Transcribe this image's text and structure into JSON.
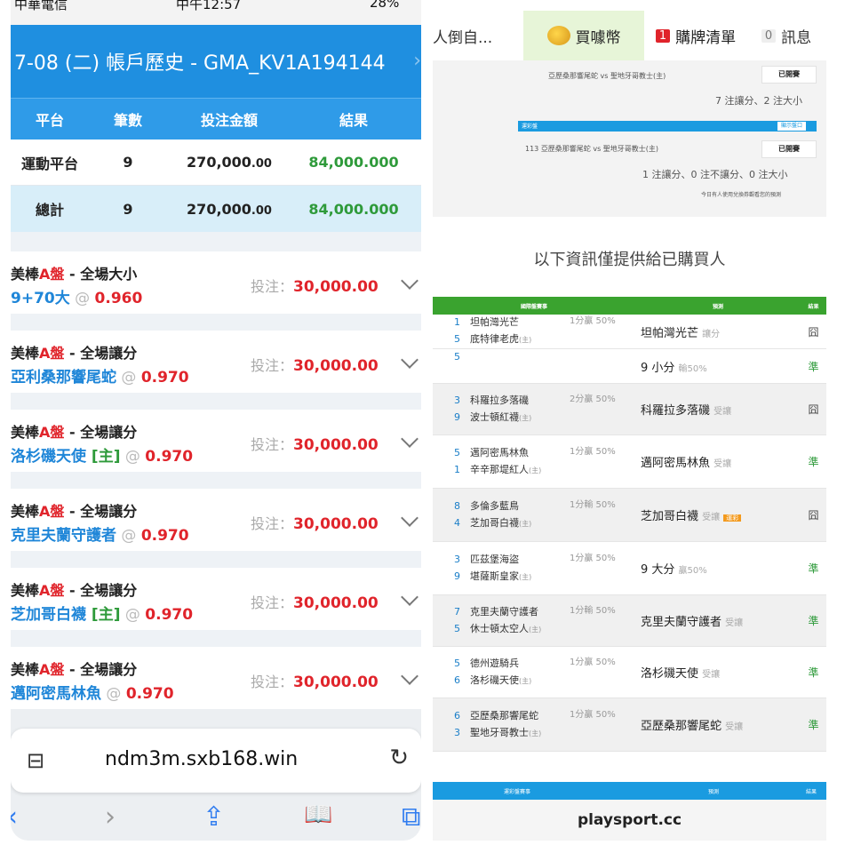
{
  "left": {
    "status": {
      "carrier": "中華電信",
      "time": "中午12:57",
      "battery": "28%"
    },
    "title": "7-08 (二) 帳戶歷史 - GMA_KV1A194144",
    "columns": [
      "平台",
      "筆數",
      "投注金額",
      "結果"
    ],
    "rows": [
      {
        "platform": "運動平台",
        "count": "9",
        "amount": "270,000",
        "amount_dec": ".00",
        "result": "84,000.000"
      },
      {
        "platform": "總計",
        "count": "9",
        "amount": "270,000",
        "amount_dec": ".00",
        "result": "84,000.000"
      }
    ],
    "bets": [
      {
        "league": "美棒",
        "tag": "A盤",
        "market": " - 全場大小",
        "selection": "9+70大",
        "host": "",
        "at": " @ ",
        "odds": "0.960",
        "stake_label": "投注：",
        "stake": "30,000.00"
      },
      {
        "league": "美棒",
        "tag": "A盤",
        "market": " - 全場讓分",
        "selection": "亞利桑那響尾蛇",
        "host": "",
        "at": " @ ",
        "odds": "0.970",
        "stake_label": "投注：",
        "stake": "30,000.00"
      },
      {
        "league": "美棒",
        "tag": "A盤",
        "market": " - 全場讓分",
        "selection": "洛杉磯天使",
        "host": " [主]",
        "at": " @ ",
        "odds": "0.970",
        "stake_label": "投注：",
        "stake": "30,000.00"
      },
      {
        "league": "美棒",
        "tag": "A盤",
        "market": " - 全場讓分",
        "selection": "克里夫蘭守護者",
        "host": "",
        "at": " @ ",
        "odds": "0.970",
        "stake_label": "投注：",
        "stake": "30,000.00"
      },
      {
        "league": "美棒",
        "tag": "A盤",
        "market": " - 全場讓分",
        "selection": "芝加哥白襪",
        "host": " [主]",
        "at": " @ ",
        "odds": "0.970",
        "stake_label": "投注：",
        "stake": "30,000.00"
      },
      {
        "league": "美棒",
        "tag": "A盤",
        "market": " - 全場讓分",
        "selection": "邁阿密馬林魚",
        "host": "",
        "at": " @ ",
        "odds": "0.970",
        "stake_label": "投注：",
        "stake": "30,000.00"
      }
    ],
    "url": "ndm3m.sxb168.win"
  },
  "right": {
    "tabs": {
      "t1": "人倒自...",
      "buy": "買噱幣",
      "list_badge": "1",
      "list": "購牌清單",
      "msg_badge": "0",
      "msg": "訊息"
    },
    "box": {
      "match1": "亞歷桑那響尾蛇 vs 聖地牙哥教士(主)",
      "closed": "已開賽",
      "summary1": "7 注讓分、2 注大小",
      "section": "運彩盤",
      "btn": "顯示盤口",
      "match2": "113  亞歷桑那響尾蛇 vs 聖地牙哥教士(主)",
      "summary2": "1 注讓分、0 注不讓分、0 注大小",
      "note": "今日有人使用兌換券觀看您的預測"
    },
    "info": "以下資訊僅提供給已購買人",
    "table_head": [
      "國際盤賽事",
      "預測",
      "結果"
    ],
    "games": [
      {
        "n1": "1",
        "t1": "坦帕灣光芒",
        "s1": "",
        "n2": "5",
        "t2": "底特律老虎",
        "s2": "(主)",
        "hcp": "1分贏 50%",
        "pick": "坦帕灣光芒",
        "pick_sub": "讓分",
        "badge": "",
        "result": "囧",
        "win": false
      },
      {
        "n1": "5",
        "t1": "",
        "s1": "",
        "n2": "",
        "t2": "",
        "s2": "",
        "hcp": "",
        "pick": "9 小分",
        "pick_sub": "輸50%",
        "badge": "",
        "result": "準",
        "win": true
      },
      {
        "n1": "3",
        "t1": "科羅拉多落磯",
        "s1": "",
        "n2": "9",
        "t2": "波士頓紅襪",
        "s2": "(主)",
        "hcp": "2分贏 50%",
        "pick": "科羅拉多落磯",
        "pick_sub": "受讓",
        "badge": "",
        "result": "囧",
        "win": false
      },
      {
        "n1": "5",
        "t1": "邁阿密馬林魚",
        "s1": "",
        "n2": "1",
        "t2": "辛辛那堤紅人",
        "s2": "(主)",
        "hcp": "1分贏 50%",
        "pick": "邁阿密馬林魚",
        "pick_sub": "受讓",
        "badge": "",
        "result": "準",
        "win": true
      },
      {
        "n1": "8",
        "t1": "多倫多藍鳥",
        "s1": "",
        "n2": "4",
        "t2": "芝加哥白襪",
        "s2": "(主)",
        "hcp": "1分輸 50%",
        "pick": "芝加哥白襪",
        "pick_sub": "受讓",
        "badge": "運彩",
        "result": "囧",
        "win": false
      },
      {
        "n1": "3",
        "t1": "匹茲堡海盜",
        "s1": "",
        "n2": "9",
        "t2": "堪薩斯皇家",
        "s2": "(主)",
        "hcp": "1分贏 50%",
        "pick": "9 大分",
        "pick_sub": "贏50%",
        "badge": "",
        "result": "準",
        "win": true
      },
      {
        "n1": "7",
        "t1": "克里夫蘭守護者",
        "s1": "",
        "n2": "5",
        "t2": "休士頓太空人",
        "s2": "(主)",
        "hcp": "1分輸 50%",
        "pick": "克里夫蘭守護者",
        "pick_sub": "受讓",
        "badge": "",
        "result": "準",
        "win": true
      },
      {
        "n1": "5",
        "t1": "德州遊騎兵",
        "s1": "",
        "n2": "6",
        "t2": "洛杉磯天使",
        "s2": "(主)",
        "hcp": "1分贏 50%",
        "pick": "洛杉磯天使",
        "pick_sub": "受讓",
        "badge": "",
        "result": "準",
        "win": true
      },
      {
        "n1": "6",
        "t1": "亞歷桑那響尾蛇",
        "s1": "",
        "n2": "3",
        "t2": "聖地牙哥教士",
        "s2": "(主)",
        "hcp": "1分贏 50%",
        "pick": "亞歷桑那響尾蛇",
        "pick_sub": "受讓",
        "badge": "",
        "result": "準",
        "win": true
      }
    ],
    "bottom_head": [
      "運彩盤賽事",
      "預測",
      "結果"
    ],
    "site": "playsport.cc"
  },
  "colors": {
    "header_blue": "#1f8fe0",
    "win_green": "#2e9a3a",
    "odds_red": "#e0242b",
    "table_green": "#3aa32f"
  }
}
